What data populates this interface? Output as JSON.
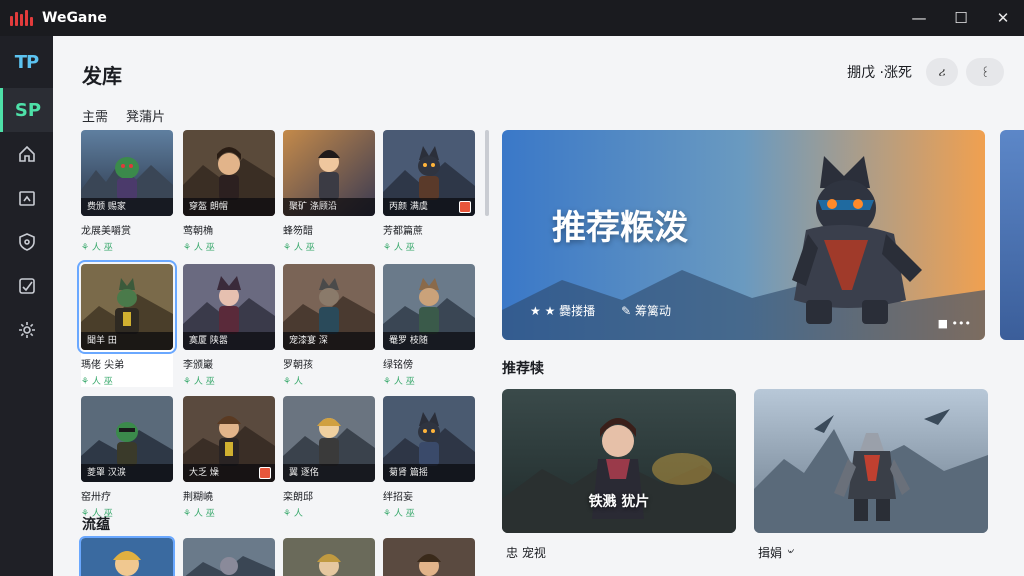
{
  "app": {
    "title": "WeGane",
    "window_controls": {
      "minimize": "—",
      "maximize": "☐",
      "close": "✕"
    }
  },
  "rail": {
    "brand": "TP",
    "active_label": "SP",
    "items": [
      "home-icon",
      "folder-icon",
      "shield-icon",
      "check-square-icon",
      "gear-icon"
    ]
  },
  "page": {
    "title": "发库",
    "header_links": "掤戊 ·涨死",
    "btn_a": "ሪ",
    "btn_b": "꒰"
  },
  "filters": [
    "主需",
    "凳蒲片"
  ],
  "games": [
    {
      "caption": "费颁  赐家",
      "title": "龙展美嚼赏",
      "meta": "⚘ 人 巫"
    },
    {
      "caption": "穿盔  朗帽",
      "title": "莺朝桷",
      "meta": "⚘ 人 巫"
    },
    {
      "caption": "聚矿  涤顾沿",
      "title": "蜂笏醋",
      "meta": "⚘ 人 巫"
    },
    {
      "caption": "丙颜  满虞",
      "title": "芳都篇蔗",
      "meta": "⚘ 人 巫"
    },
    {
      "caption": "聞羊  田",
      "title": "瑪佬 尖弟",
      "meta": "⚘ 人 巫"
    },
    {
      "caption": "寞厦  陕嚣",
      "title": "李颁巖",
      "meta": "⚘ 人 巫"
    },
    {
      "caption": "宠漆宴  深",
      "title": "罗朝孩",
      "meta": "⚘ 人"
    },
    {
      "caption": "罨罗  枝随",
      "title": "绿铭傍",
      "meta": "⚘ 人 巫"
    },
    {
      "caption": "菱罩  汉涙",
      "title": "窑卅疗",
      "meta": "⚘ 人 巫"
    },
    {
      "caption": "大乏  燥",
      "title": "荆糊嶢",
      "meta": "⚘ 人 巫"
    },
    {
      "caption": "翼  逐佲",
      "title": "栾朗邱",
      "meta": "⚘ 人"
    },
    {
      "caption": "菊肾  篇摇",
      "title": "绊招妄",
      "meta": "⚘ 人 巫"
    }
  ],
  "section2_title": "流蕴",
  "banner": {
    "title": "推荐糇泼",
    "action1": "★ ★ 爨搂播",
    "action2": "✎ 筹篱动",
    "dots": "■ •••"
  },
  "recommend": {
    "title": "推荐犊",
    "cards": [
      {
        "label": "铁溅  犹片",
        "caption": "忠  宠视"
      },
      {
        "label": "",
        "caption": "揖娟  ৺"
      }
    ]
  },
  "colors": {
    "accent": "#4ee0a8",
    "brand_red": "#e23b3b",
    "rail_bg": "#1f2026"
  }
}
